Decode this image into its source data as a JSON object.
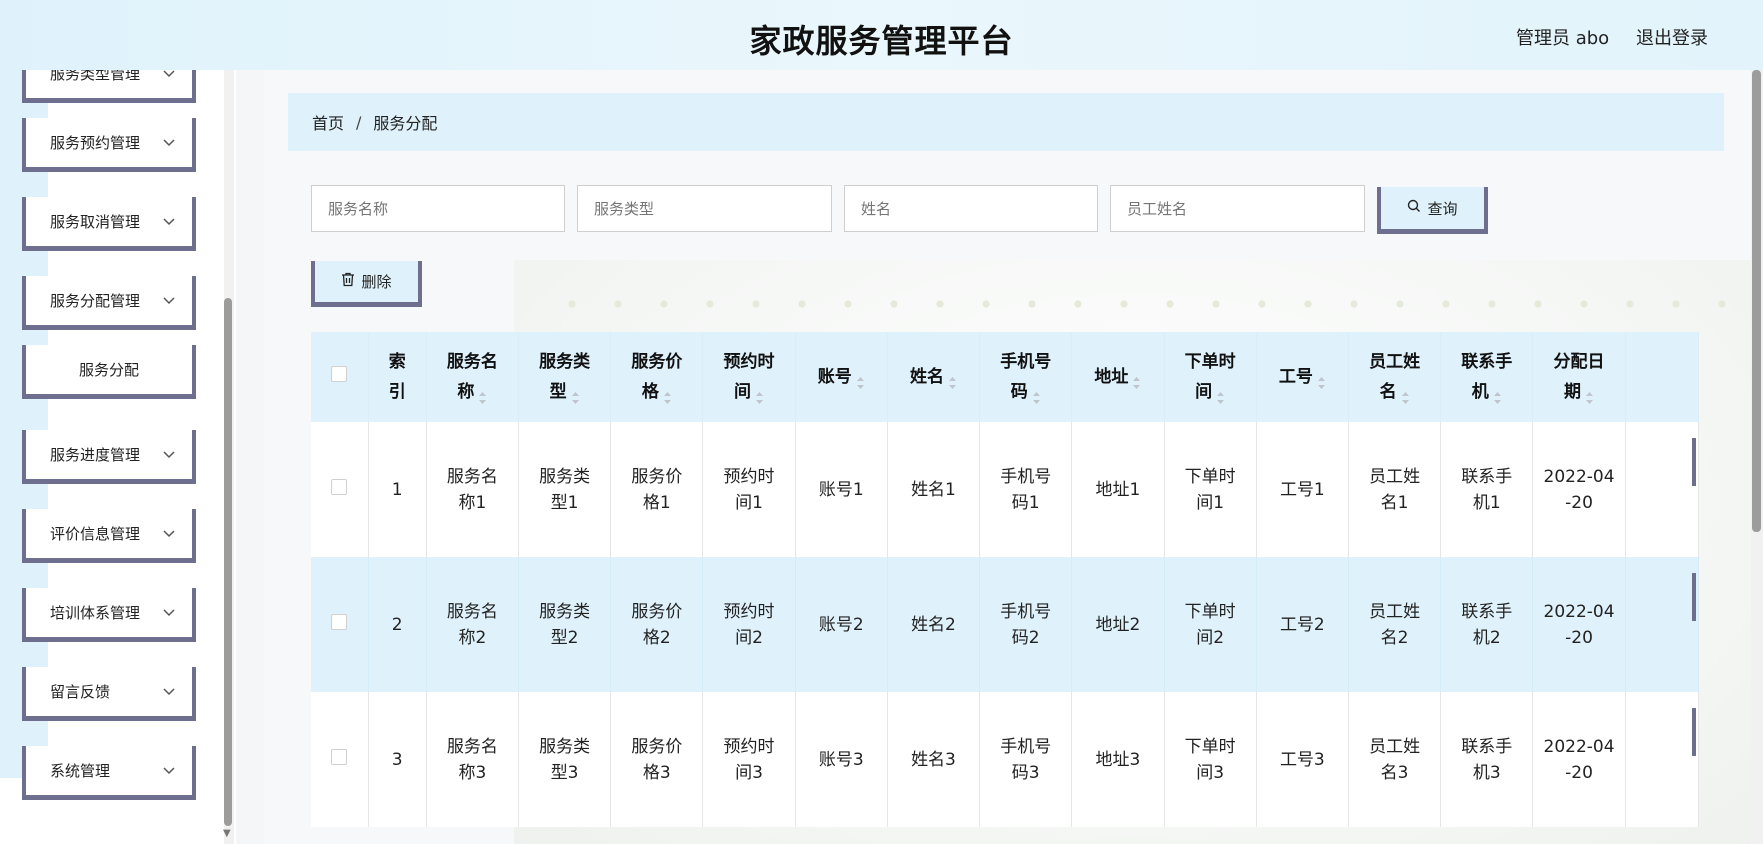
{
  "header": {
    "title": "家政服务管理平台",
    "admin_label": "管理员 abo",
    "logout_label": "退出登录"
  },
  "sidebar": {
    "items": [
      {
        "label": "服务类型管理",
        "expandable": true
      },
      {
        "label": "服务预约管理",
        "expandable": true
      },
      {
        "label": "服务取消管理",
        "expandable": true
      },
      {
        "label": "服务分配管理",
        "expandable": true
      },
      {
        "label": "服务分配",
        "expandable": false
      },
      {
        "label": "服务进度管理",
        "expandable": true
      },
      {
        "label": "评价信息管理",
        "expandable": true
      },
      {
        "label": "培训体系管理",
        "expandable": true
      },
      {
        "label": "留言反馈",
        "expandable": true
      },
      {
        "label": "系统管理",
        "expandable": true
      }
    ]
  },
  "breadcrumb": {
    "home": "首页",
    "separator": "/",
    "current": "服务分配"
  },
  "search": {
    "service_name_placeholder": "服务名称",
    "service_type_placeholder": "服务类型",
    "name_placeholder": "姓名",
    "employee_name_placeholder": "员工姓名",
    "query_label": "查询"
  },
  "actions": {
    "delete_label": "删除"
  },
  "table": {
    "headers": [
      {
        "line1": "索",
        "line2": "引",
        "sortable": false
      },
      {
        "line1": "服务名",
        "line2": "称",
        "sortable": true
      },
      {
        "line1": "服务类",
        "line2": "型",
        "sortable": true
      },
      {
        "line1": "服务价",
        "line2": "格",
        "sortable": true
      },
      {
        "line1": "预约时",
        "line2": "间",
        "sortable": true
      },
      {
        "line1": "账号",
        "line2": "",
        "sortable": true
      },
      {
        "line1": "姓名",
        "line2": "",
        "sortable": true
      },
      {
        "line1": "手机号",
        "line2": "码",
        "sortable": true
      },
      {
        "line1": "地址",
        "line2": "",
        "sortable": true
      },
      {
        "line1": "下单时",
        "line2": "间",
        "sortable": true
      },
      {
        "line1": "工号",
        "line2": "",
        "sortable": true
      },
      {
        "line1": "员工姓",
        "line2": "名",
        "sortable": true
      },
      {
        "line1": "联系手",
        "line2": "机",
        "sortable": true
      },
      {
        "line1": "分配日",
        "line2": "期",
        "sortable": true
      }
    ],
    "rows": [
      [
        [
          "1"
        ],
        [
          "服务名",
          "称1"
        ],
        [
          "服务类",
          "型1"
        ],
        [
          "服务价",
          "格1"
        ],
        [
          "预约时",
          "间1"
        ],
        [
          "账号1"
        ],
        [
          "姓名1"
        ],
        [
          "手机号",
          "码1"
        ],
        [
          "地址1"
        ],
        [
          "下单时",
          "间1"
        ],
        [
          "工号1"
        ],
        [
          "员工姓",
          "名1"
        ],
        [
          "联系手",
          "机1"
        ],
        [
          "2022-04",
          "-20"
        ]
      ],
      [
        [
          "2"
        ],
        [
          "服务名",
          "称2"
        ],
        [
          "服务类",
          "型2"
        ],
        [
          "服务价",
          "格2"
        ],
        [
          "预约时",
          "间2"
        ],
        [
          "账号2"
        ],
        [
          "姓名2"
        ],
        [
          "手机号",
          "码2"
        ],
        [
          "地址2"
        ],
        [
          "下单时",
          "间2"
        ],
        [
          "工号2"
        ],
        [
          "员工姓",
          "名2"
        ],
        [
          "联系手",
          "机2"
        ],
        [
          "2022-04",
          "-20"
        ]
      ],
      [
        [
          "3"
        ],
        [
          "服务名",
          "称3"
        ],
        [
          "服务类",
          "型3"
        ],
        [
          "服务价",
          "格3"
        ],
        [
          "预约时",
          "间3"
        ],
        [
          "账号3"
        ],
        [
          "姓名3"
        ],
        [
          "手机号",
          "码3"
        ],
        [
          "地址3"
        ],
        [
          "下单时",
          "间3"
        ],
        [
          "工号3"
        ],
        [
          "员工姓",
          "名3"
        ],
        [
          "联系手",
          "机3"
        ],
        [
          "2022-04",
          "-20"
        ]
      ]
    ]
  },
  "colors": {
    "accent_light_blue": "#dff2fb",
    "border_slate": "#6e6e8e",
    "text_dark": "#222222"
  },
  "icons": {
    "chevron": "chevron-down-icon",
    "search": "search-icon",
    "delete": "trash-icon",
    "sort": "sort-icon"
  }
}
